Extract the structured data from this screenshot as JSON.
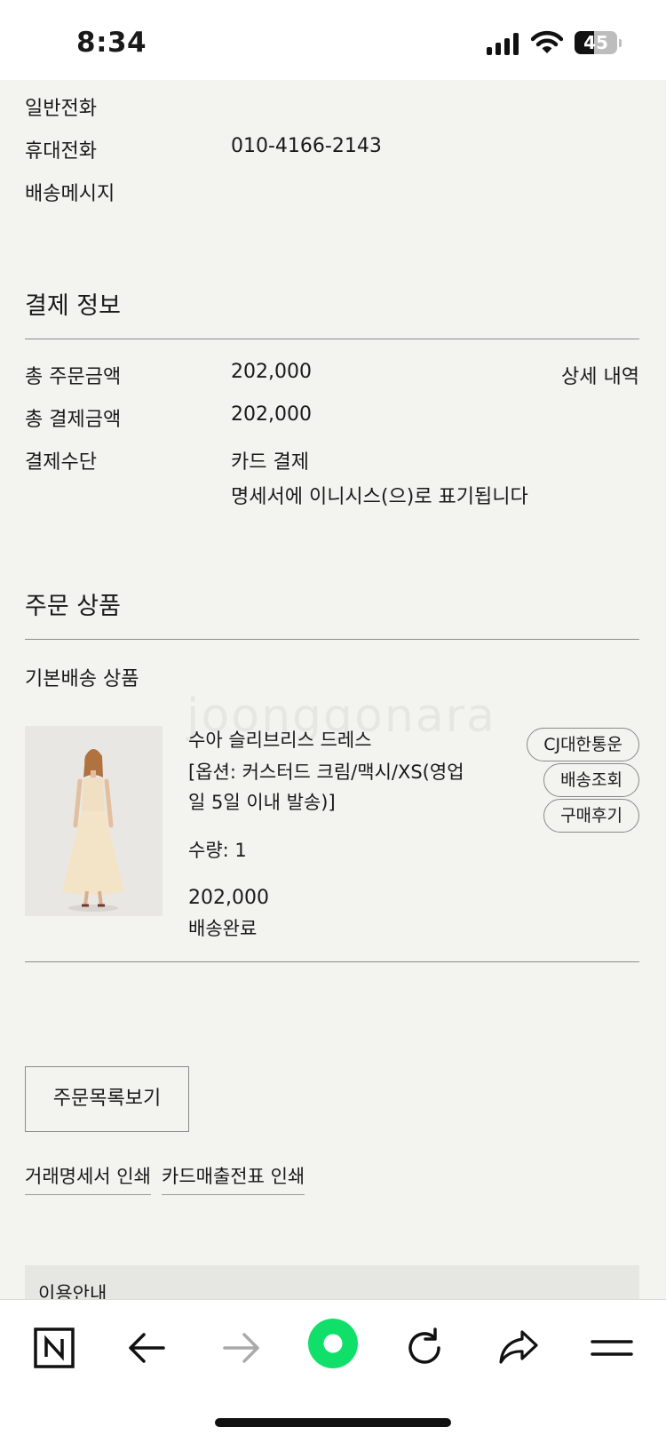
{
  "status_bar": {
    "time": "8:34",
    "battery": "45"
  },
  "shipping": {
    "landline_label": "일반전화",
    "mobile_label": "휴대전화",
    "mobile_value": "010-4166-2143",
    "message_label": "배송메시지"
  },
  "payment": {
    "title": "결제 정보",
    "total_order_label": "총 주문금액",
    "total_order_value": "202,000",
    "detail_link": "상세 내역",
    "total_paid_label": "총 결제금액",
    "total_paid_value": "202,000",
    "method_label": "결제수단",
    "method_value": "카드 결제",
    "statement_note": "명세서에 이니시스(으)로 표기됩니다"
  },
  "order_items": {
    "title": "주문 상품",
    "group_label": "기본배송 상품",
    "product": {
      "name": "수아 슬리브리스 드레스",
      "option_line1": "[옵션: 커스터드 크림/맥시/XS(영업",
      "option_line2": "일 5일 이내 발송)]",
      "quantity": "수량: 1",
      "price": "202,000",
      "status": "배송완료",
      "carrier_button": "CJ대한통운",
      "track_button": "배송조회",
      "review_button": "구매후기"
    }
  },
  "actions": {
    "order_list_button": "주문목록보기",
    "print_statement": "거래명세서 인쇄",
    "print_card_receipt": "카드매출전표 인쇄"
  },
  "guide": {
    "title": "이용안내"
  },
  "watermark": "joonggonara",
  "toolbar": {
    "icons": [
      "naver-n-icon",
      "back-arrow-icon",
      "forward-arrow-icon",
      "green-dot-icon",
      "reload-icon",
      "share-icon",
      "menu-icon"
    ]
  }
}
